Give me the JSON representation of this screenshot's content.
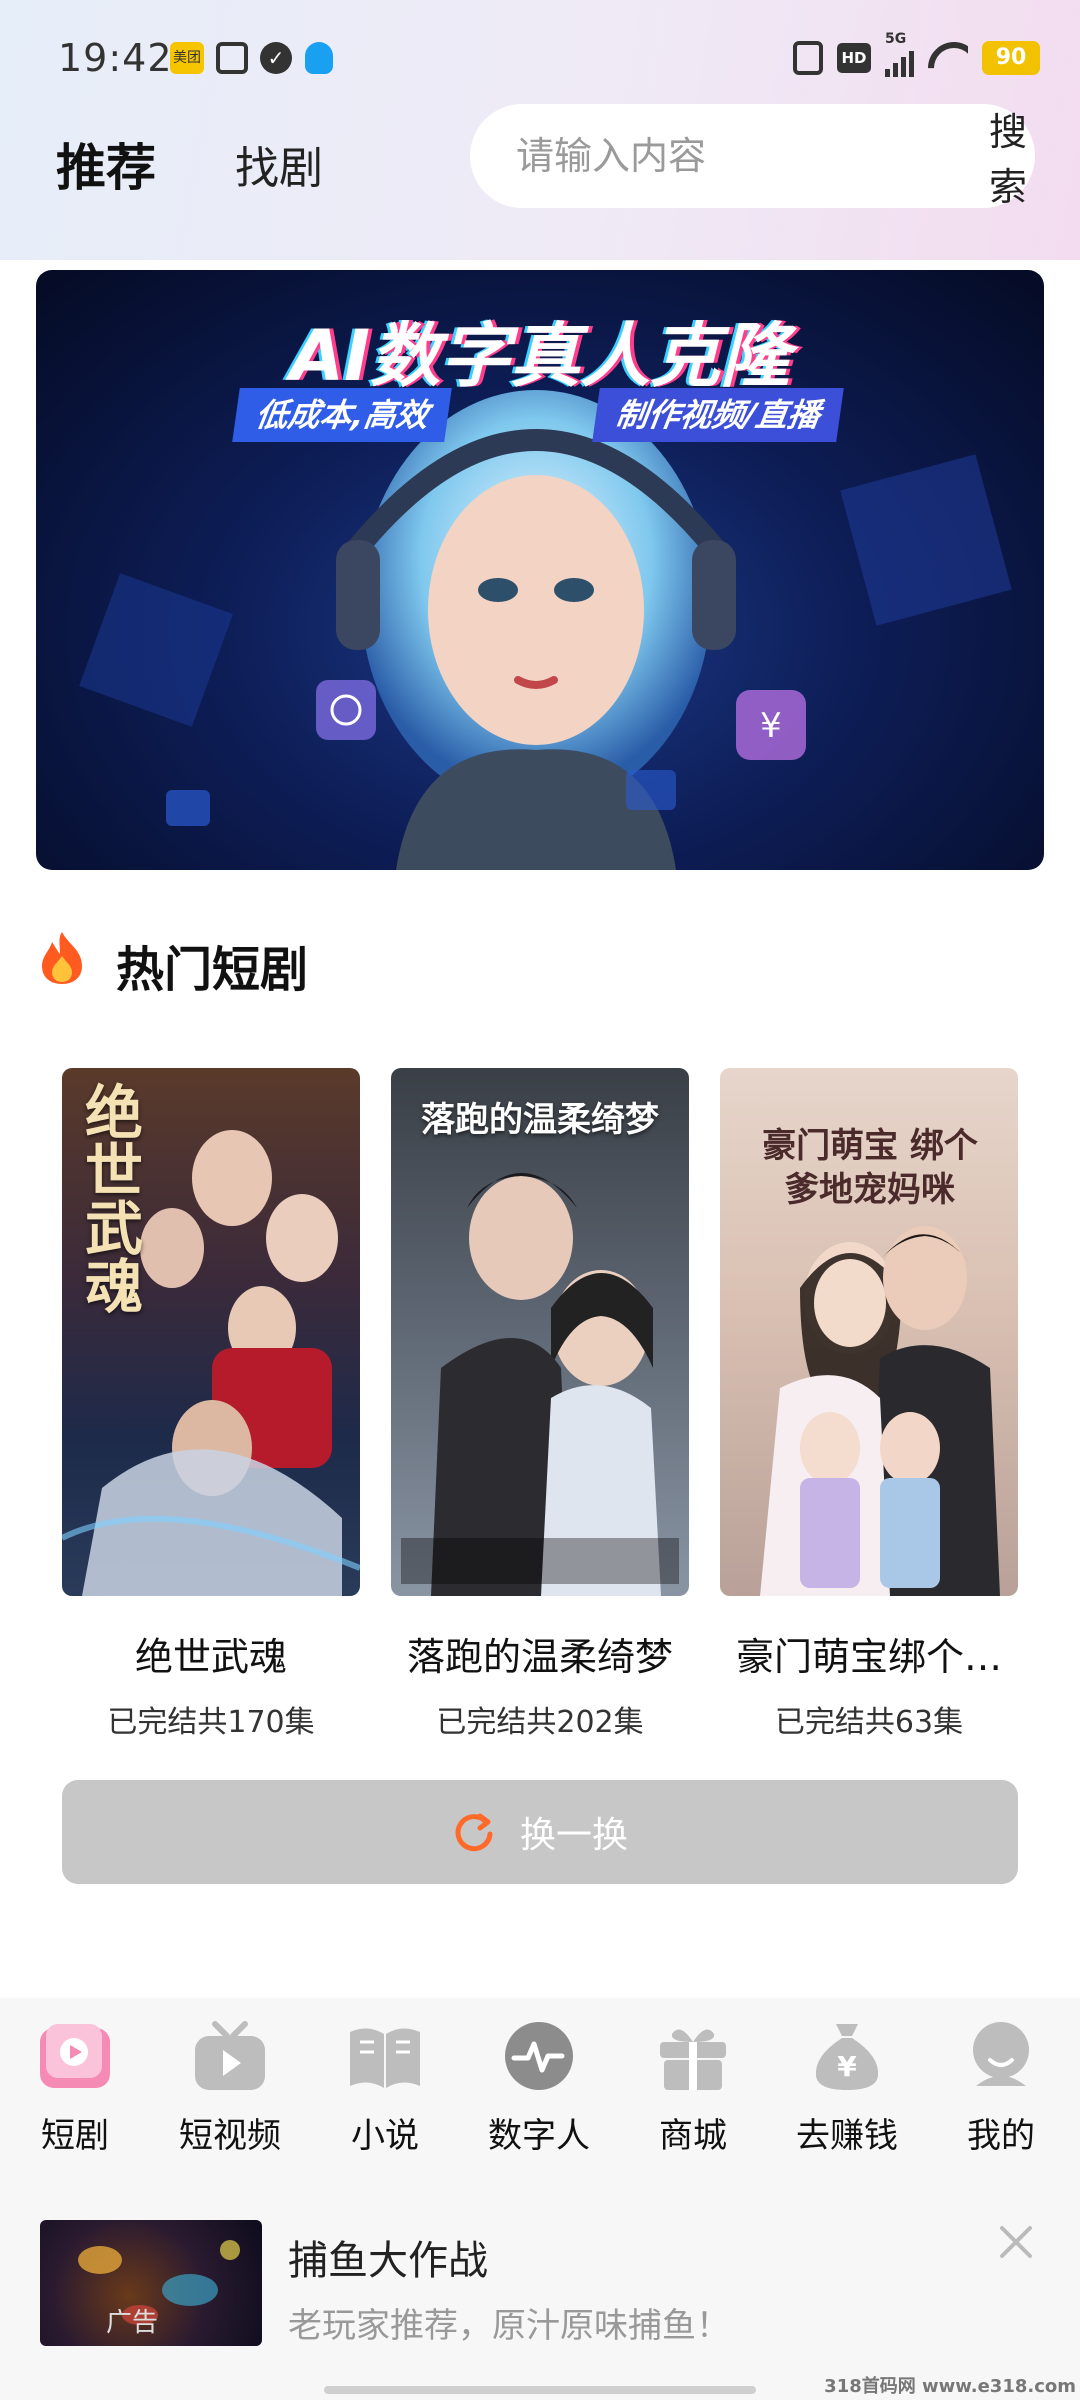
{
  "status_bar": {
    "time": "19:42",
    "meituan_badge": "美团",
    "network": "5G",
    "hd": "HD",
    "battery": "90"
  },
  "header": {
    "tab_recommend": "推荐",
    "tab_find": "找剧",
    "search_placeholder": "请输入内容",
    "search_button": "搜索"
  },
  "banner": {
    "title": "AI数字真人克隆",
    "tag_left": "低成本,高效",
    "tag_right": "制作视频/直播"
  },
  "section": {
    "title": "热门短剧",
    "icon": "fire-icon"
  },
  "dramas": [
    {
      "name": "绝世武魂",
      "episodes": "已完结共170集",
      "poster_text": "绝世武魂"
    },
    {
      "name": "落跑的温柔绮梦",
      "episodes": "已完结共202集",
      "poster_text": "落跑的温柔绮梦"
    },
    {
      "name": "豪门萌宝绑个…",
      "episodes": "已完结共63集",
      "poster_text": "豪门萌宝 绑个爹地宠妈咪"
    }
  ],
  "refresh_label": "换一换",
  "nav": [
    {
      "label": "短剧",
      "icon": "short-drama-icon",
      "active": true
    },
    {
      "label": "短视频",
      "icon": "tv-play-icon"
    },
    {
      "label": "小说",
      "icon": "book-icon"
    },
    {
      "label": "数字人",
      "icon": "pulse-icon"
    },
    {
      "label": "商城",
      "icon": "gift-icon"
    },
    {
      "label": "去赚钱",
      "icon": "money-bag-icon"
    },
    {
      "label": "我的",
      "icon": "user-icon"
    }
  ],
  "ad": {
    "title": "捕鱼大作战",
    "desc": "老玩家推荐，原汁原味捕鱼！",
    "tag": "广告"
  },
  "watermark": "318首码网 www.e318.com",
  "colors": {
    "accent": "#ff6a2a",
    "refresh_bg": "#c7c7c7",
    "nav_icon": "#bdbdbd",
    "active_icon": "#f58ab4"
  }
}
